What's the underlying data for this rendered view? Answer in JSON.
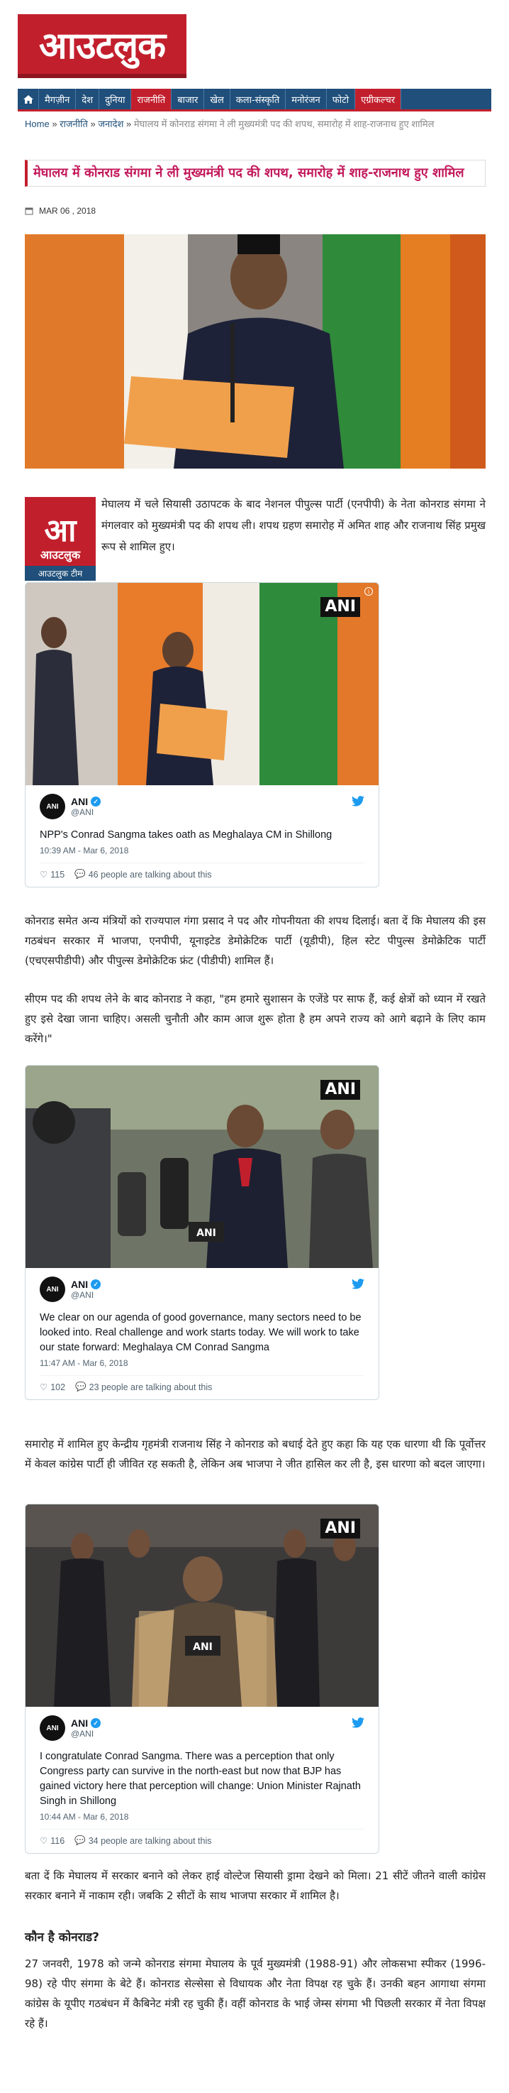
{
  "site": {
    "logo_text": "आउटलुक"
  },
  "nav": {
    "home_icon": "home-icon",
    "items": [
      "मैगज़ीन",
      "देश",
      "दुनिया",
      "राजनीति",
      "बाजार",
      "खेल",
      "कला-संस्कृति",
      "मनोरंजन",
      "फोटो",
      "एग्रीकल्चर"
    ],
    "active": "राजनीति",
    "colors": {
      "bar": "#1f4f7a",
      "accent": "#c21f2d"
    }
  },
  "breadcrumb": {
    "home": "Home",
    "sep": "»",
    "section": "राजनीति",
    "subsection": "जनादेश",
    "current": "मेघालय में कोनराड संगमा ने ली मुख्यमंत्री पद की शपथ, समारोह में शाह-राजनाथ हुए शामिल"
  },
  "article": {
    "title": "मेघालय में कोनराड संगमा ने ली मुख्यमंत्री पद की शपथ, समारोह में शाह-राजनाथ हुए शामिल",
    "date": "MAR 06 , 2018",
    "author_logo_big": "आ",
    "author_logo_mid": "आउटलुक",
    "author_tag": "आउटलुक टीम",
    "intro": "मेघालय में चले सियासी उठापटक के बाद नेशनल पीपुल्स पार्टी (एनपीपी) के नेता कोनराड संगमा ने मंगलवार को मुख्यमंत्री पद की शपथ ली। शपथ ग्रहण समारोह में अमित शाह और राजनाथ सिंह प्रमुख रूप से शामिल हुए।",
    "p1": "कोनराड समेत अन्य मंत्रियों को राज्यपाल गंगा प्रसाद ने पद और गोपनीयता की शपथ दिलाई। बता दें कि मेघालय की इस गठबंधन सरकार में भाजपा, एनपीपी, यूनाइटेड डेमोक्रेटिक पार्टी (यूडीपी), हिल स्टेट पीपुल्स डेमोक्रेटिक पार्टी (एचएसपीडीपी) और पीपुल्स डेमोक्रेटिक फ्रंट (पीडीपी) शामिल हैं।",
    "p2": "सीएम पद की शपथ लेने के बाद कोनराड ने कहा, \"हम हमारे सुशासन के एजेंडे पर साफ हैं, कई क्षेत्रों को ध्यान में रखते हुए इसे देखा जाना चाहिए। असली चुनौती और काम आज शुरू होता है हम अपने राज्य को आगे बढ़ाने के लिए काम करेंगे।\"",
    "p3": "समारोह में शामिल हुए केन्द्रीय गृहमंत्री राजनाथ सिंह ने कोनराड को बधाई देते हुए कहा कि यह एक धारणा थी कि पूर्वोत्तर में केवल कांग्रेस पार्टी ही जीवित रह सकती है, लेकिन अब भाजपा ने जीत हासिल कर ली है, इस धारणा को बदल जाएगा।",
    "p4": "बता दें कि मेघालय में सरकार बनाने को लेकर हाई वोल्टेज सियासी ड्रामा देखने को मिला। 21 सीटें जीतने वाली कांग्रेस सरकार बनाने में नाकाम रही। जबकि 2 सीटों के साथ भाजपा सरकार में शामिल है।",
    "subhead": "कौन है कोनराड?",
    "p5": "27 जनवरी, 1978 को जन्मे कोनराड संगमा मेघालय के पूर्व मुख्यमंत्री (1988-91) और लोकसभा स्पीकर (1996-98) रहे पीए संगमा के बेटे हैं। कोनराड सेल्सेसा से विधायक और नेता विपक्ष रह चुके हैं। उनकी बहन आगाथा संगमा कांग्रेस के यूपीए गठबंधन में कैबिनेट मंत्री रह चुकी हैं। वहीं कोनराड के भाई जेम्स संगमा भी पिछली सरकार में नेता विपक्ष रहे हैं।"
  },
  "tweets": [
    {
      "name": "ANI",
      "handle": "@ANI",
      "watermark": "ANI",
      "text": "NPP's Conrad Sangma takes oath as Meghalaya CM in Shillong",
      "time": "10:39 AM - Mar 6, 2018",
      "likes": "115",
      "talking": "46 people are talking about this"
    },
    {
      "name": "ANI",
      "handle": "@ANI",
      "watermark": "ANI",
      "text": "We clear on our agenda of good governance, many sectors need to be looked into. Real challenge and work starts today. We will work to take our state forward: Meghalaya CM Conrad Sangma",
      "time": "11:47 AM - Mar 6, 2018",
      "likes": "102",
      "talking": "23 people are talking about this"
    },
    {
      "name": "ANI",
      "handle": "@ANI",
      "watermark": "ANI",
      "text": "I congratulate Conrad Sangma. There was a perception that only Congress party can survive in the north-east but now that BJP has gained victory here that perception will change: Union Minister Rajnath Singh in Shillong",
      "time": "10:44 AM - Mar 6, 2018",
      "likes": "116",
      "talking": "34 people are talking about this"
    }
  ]
}
